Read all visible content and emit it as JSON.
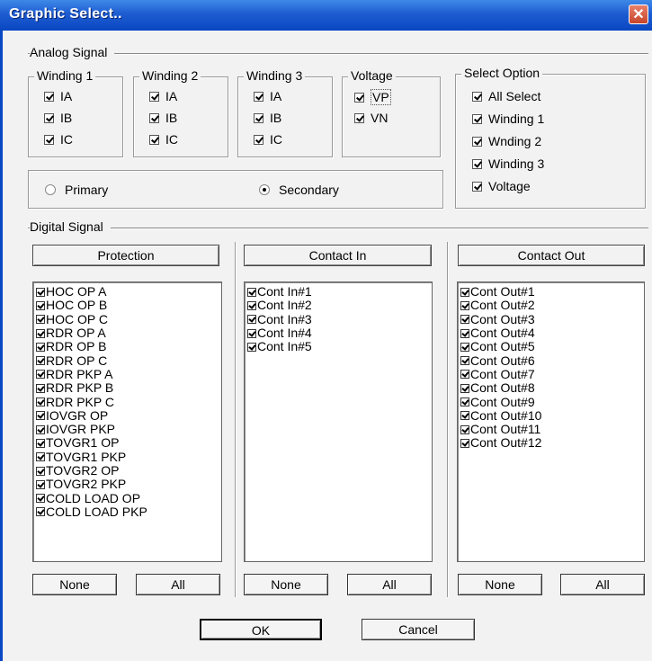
{
  "window": {
    "title": "Graphic Select..",
    "close_glyph": "✕"
  },
  "analog": {
    "section_label": "Analog Signal",
    "winding1": {
      "label": "Winding 1",
      "items": [
        "IA",
        "IB",
        "IC"
      ]
    },
    "winding2": {
      "label": "Winding 2",
      "items": [
        "IA",
        "IB",
        "IC"
      ]
    },
    "winding3": {
      "label": "Winding 3",
      "items": [
        "IA",
        "IB",
        "IC"
      ]
    },
    "voltage": {
      "label": "Voltage",
      "items": [
        "VP",
        "VN"
      ]
    },
    "select_option": {
      "label": "Select Option",
      "items": [
        "All Select",
        "Winding 1",
        "Wnding 2",
        "Winding 3",
        "Voltage"
      ]
    },
    "primary_label": "Primary",
    "secondary_label": "Secondary",
    "selected_radio": "Secondary"
  },
  "digital": {
    "section_label": "Digital Signal",
    "protection": {
      "header": "Protection",
      "items": [
        "HOC OP A",
        "HOC OP B",
        "HOC OP C",
        "RDR OP A",
        "RDR OP B",
        "RDR OP C",
        "RDR PKP A",
        "RDR PKP B",
        "RDR PKP C",
        "IOVGR OP",
        "IOVGR PKP",
        "TOVGR1 OP",
        "TOVGR1 PKP",
        "TOVGR2 OP",
        "TOVGR2 PKP",
        "COLD LOAD OP",
        "COLD LOAD PKP"
      ]
    },
    "contact_in": {
      "header": "Contact In",
      "items": [
        "Cont In#1",
        "Cont In#2",
        "Cont In#3",
        "Cont In#4",
        "Cont In#5"
      ]
    },
    "contact_out": {
      "header": "Contact Out",
      "items": [
        "Cont Out#1",
        "Cont Out#2",
        "Cont Out#3",
        "Cont Out#4",
        "Cont Out#5",
        "Cont Out#6",
        "Cont Out#7",
        "Cont Out#8",
        "Cont Out#9",
        "Cont Out#10",
        "Cont Out#11",
        "Cont Out#12"
      ]
    },
    "none_label": "None",
    "all_label": "All"
  },
  "footer": {
    "ok_label": "OK",
    "cancel_label": "Cancel"
  }
}
